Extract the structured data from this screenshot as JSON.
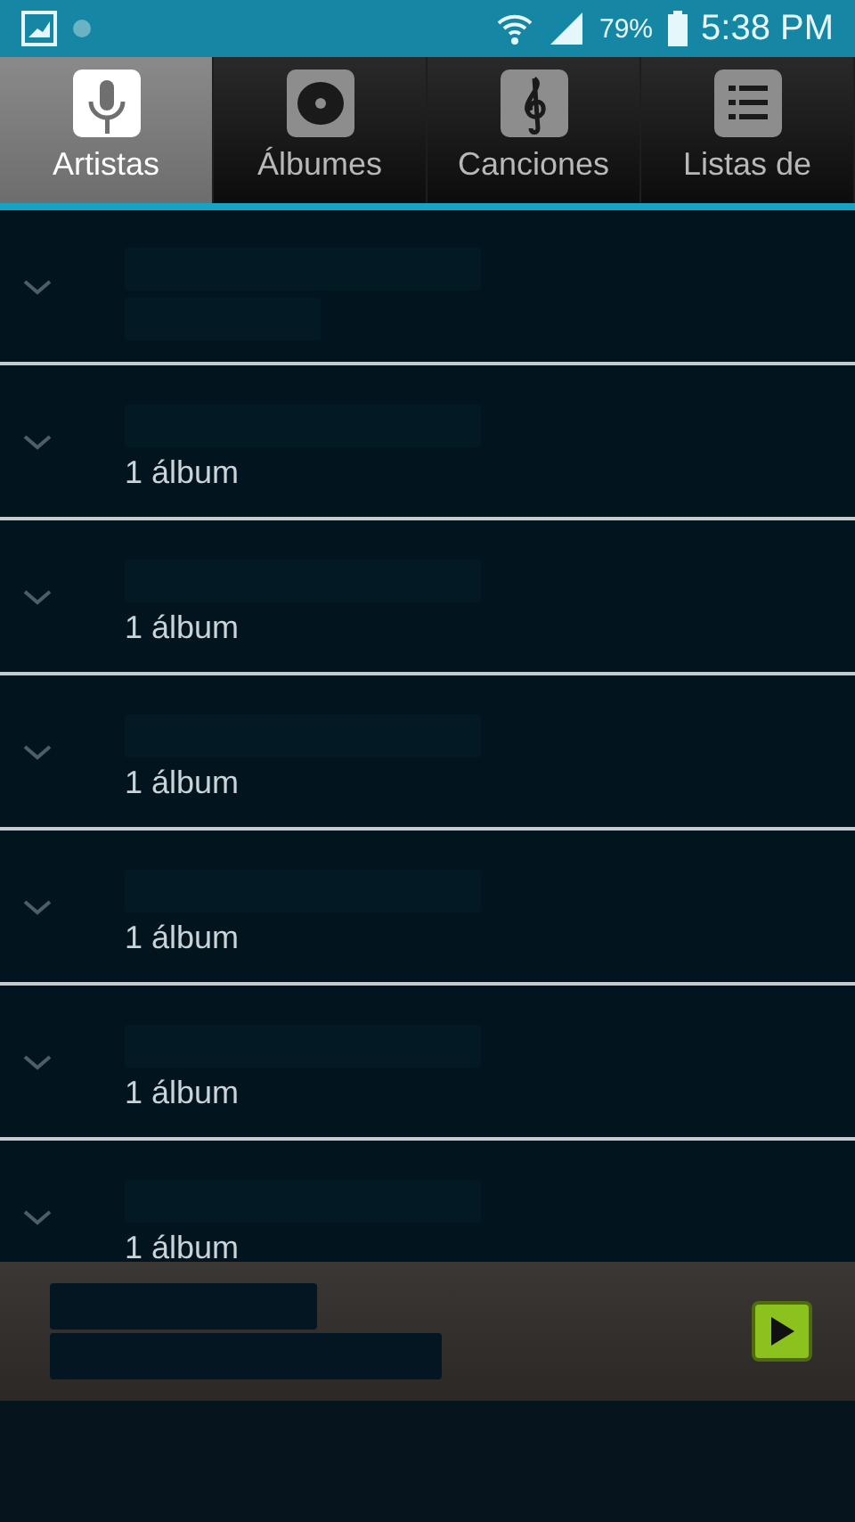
{
  "status_bar": {
    "battery": "79%",
    "time": "5:38 PM"
  },
  "tabs": [
    {
      "label": "Artistas",
      "kind": "mic",
      "selected": true
    },
    {
      "label": "Álbumes",
      "kind": "disc",
      "selected": false
    },
    {
      "label": "Canciones",
      "kind": "clef",
      "selected": false
    },
    {
      "label": "Listas de",
      "kind": "list",
      "selected": false
    }
  ],
  "artists": [
    {
      "kind": "obscured"
    },
    {
      "subtitle": "1 álbum"
    },
    {
      "subtitle": "1 álbum"
    },
    {
      "subtitle": "1 álbum"
    },
    {
      "subtitle": "1 álbum"
    },
    {
      "subtitle": "1 álbum"
    },
    {
      "subtitle": "1 álbum"
    }
  ],
  "mini_player": {
    "playing": false
  }
}
